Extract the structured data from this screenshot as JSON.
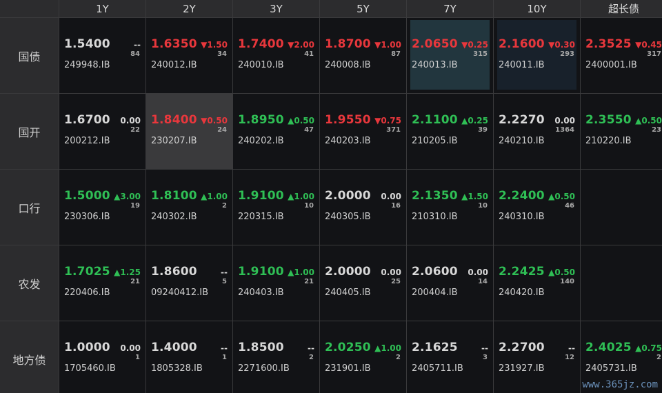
{
  "columns": [
    "1Y",
    "2Y",
    "3Y",
    "5Y",
    "7Y",
    "10Y",
    "超长债"
  ],
  "rows": [
    {
      "label": "国债",
      "cells": [
        {
          "price": "1.5400",
          "chg": "--",
          "vol": "84",
          "code": "249948.IB",
          "dir": "flat"
        },
        {
          "price": "1.6350",
          "chg": "▼1.50",
          "vol": "34",
          "code": "240012.IB",
          "dir": "down"
        },
        {
          "price": "1.7400",
          "chg": "▼2.00",
          "vol": "41",
          "code": "240010.IB",
          "dir": "down"
        },
        {
          "price": "1.8700",
          "chg": "▼1.00",
          "vol": "87",
          "code": "240008.IB",
          "dir": "down"
        },
        {
          "price": "2.0650",
          "chg": "▼0.25",
          "vol": "315",
          "code": "240013.IB",
          "dir": "down",
          "hl": "teal"
        },
        {
          "price": "2.1600",
          "chg": "▼0.30",
          "vol": "293",
          "code": "240011.IB",
          "dir": "down",
          "hl": "navy"
        },
        {
          "price": "2.3525",
          "chg": "▼0.45",
          "vol": "317",
          "code": "2400001.IB",
          "dir": "down"
        }
      ]
    },
    {
      "label": "国开",
      "cells": [
        {
          "price": "1.6700",
          "chg": "0.00",
          "vol": "22",
          "code": "200212.IB",
          "dir": "flat"
        },
        {
          "price": "1.8400",
          "chg": "▼0.50",
          "vol": "24",
          "code": "230207.IB",
          "dir": "down",
          "hl": "gray"
        },
        {
          "price": "1.8950",
          "chg": "▲0.50",
          "vol": "47",
          "code": "240202.IB",
          "dir": "up"
        },
        {
          "price": "1.9550",
          "chg": "▼0.75",
          "vol": "371",
          "code": "240203.IB",
          "dir": "down"
        },
        {
          "price": "2.1100",
          "chg": "▲0.25",
          "vol": "39",
          "code": "210205.IB",
          "dir": "up"
        },
        {
          "price": "2.2270",
          "chg": "0.00",
          "vol": "1364",
          "code": "240210.IB",
          "dir": "flat"
        },
        {
          "price": "2.3550",
          "chg": "▲0.50",
          "vol": "23",
          "code": "210220.IB",
          "dir": "up"
        }
      ]
    },
    {
      "label": "口行",
      "cells": [
        {
          "price": "1.5000",
          "chg": "▲3.00",
          "vol": "19",
          "code": "230306.IB",
          "dir": "up"
        },
        {
          "price": "1.8100",
          "chg": "▲1.00",
          "vol": "2",
          "code": "240302.IB",
          "dir": "up"
        },
        {
          "price": "1.9100",
          "chg": "▲1.00",
          "vol": "10",
          "code": "220315.IB",
          "dir": "up"
        },
        {
          "price": "2.0000",
          "chg": "0.00",
          "vol": "16",
          "code": "240305.IB",
          "dir": "flat"
        },
        {
          "price": "2.1350",
          "chg": "▲1.50",
          "vol": "10",
          "code": "210310.IB",
          "dir": "up"
        },
        {
          "price": "2.2400",
          "chg": "▲0.50",
          "vol": "46",
          "code": "240310.IB",
          "dir": "up"
        },
        null
      ]
    },
    {
      "label": "农发",
      "cells": [
        {
          "price": "1.7025",
          "chg": "▲1.25",
          "vol": "21",
          "code": "220406.IB",
          "dir": "up"
        },
        {
          "price": "1.8600",
          "chg": "--",
          "vol": "5",
          "code": "09240412.IB",
          "dir": "flat"
        },
        {
          "price": "1.9100",
          "chg": "▲1.00",
          "vol": "21",
          "code": "240403.IB",
          "dir": "up"
        },
        {
          "price": "2.0000",
          "chg": "0.00",
          "vol": "25",
          "code": "240405.IB",
          "dir": "flat"
        },
        {
          "price": "2.0600",
          "chg": "0.00",
          "vol": "14",
          "code": "200404.IB",
          "dir": "flat"
        },
        {
          "price": "2.2425",
          "chg": "▲0.50",
          "vol": "140",
          "code": "240420.IB",
          "dir": "up"
        },
        null
      ]
    },
    {
      "label": "地方债",
      "cells": [
        {
          "price": "1.0000",
          "chg": "0.00",
          "vol": "1",
          "code": "1705460.IB",
          "dir": "flat"
        },
        {
          "price": "1.4000",
          "chg": "--",
          "vol": "1",
          "code": "1805328.IB",
          "dir": "flat"
        },
        {
          "price": "1.8500",
          "chg": "--",
          "vol": "2",
          "code": "2271600.IB",
          "dir": "flat"
        },
        {
          "price": "2.0250",
          "chg": "▲1.00",
          "vol": "2",
          "code": "231901.IB",
          "dir": "up"
        },
        {
          "price": "2.1625",
          "chg": "--",
          "vol": "3",
          "code": "2405711.IB",
          "dir": "flat"
        },
        {
          "price": "2.2700",
          "chg": "--",
          "vol": "12",
          "code": "231927.IB",
          "dir": "flat"
        },
        {
          "price": "2.4025",
          "chg": "▲0.75",
          "vol": "2",
          "code": "2405731.IB",
          "dir": "up"
        }
      ]
    }
  ],
  "watermark": "www.365jz.com",
  "colors": {
    "up": "#2fbf55",
    "down": "#e8373c",
    "flat": "#d8d8d8"
  }
}
